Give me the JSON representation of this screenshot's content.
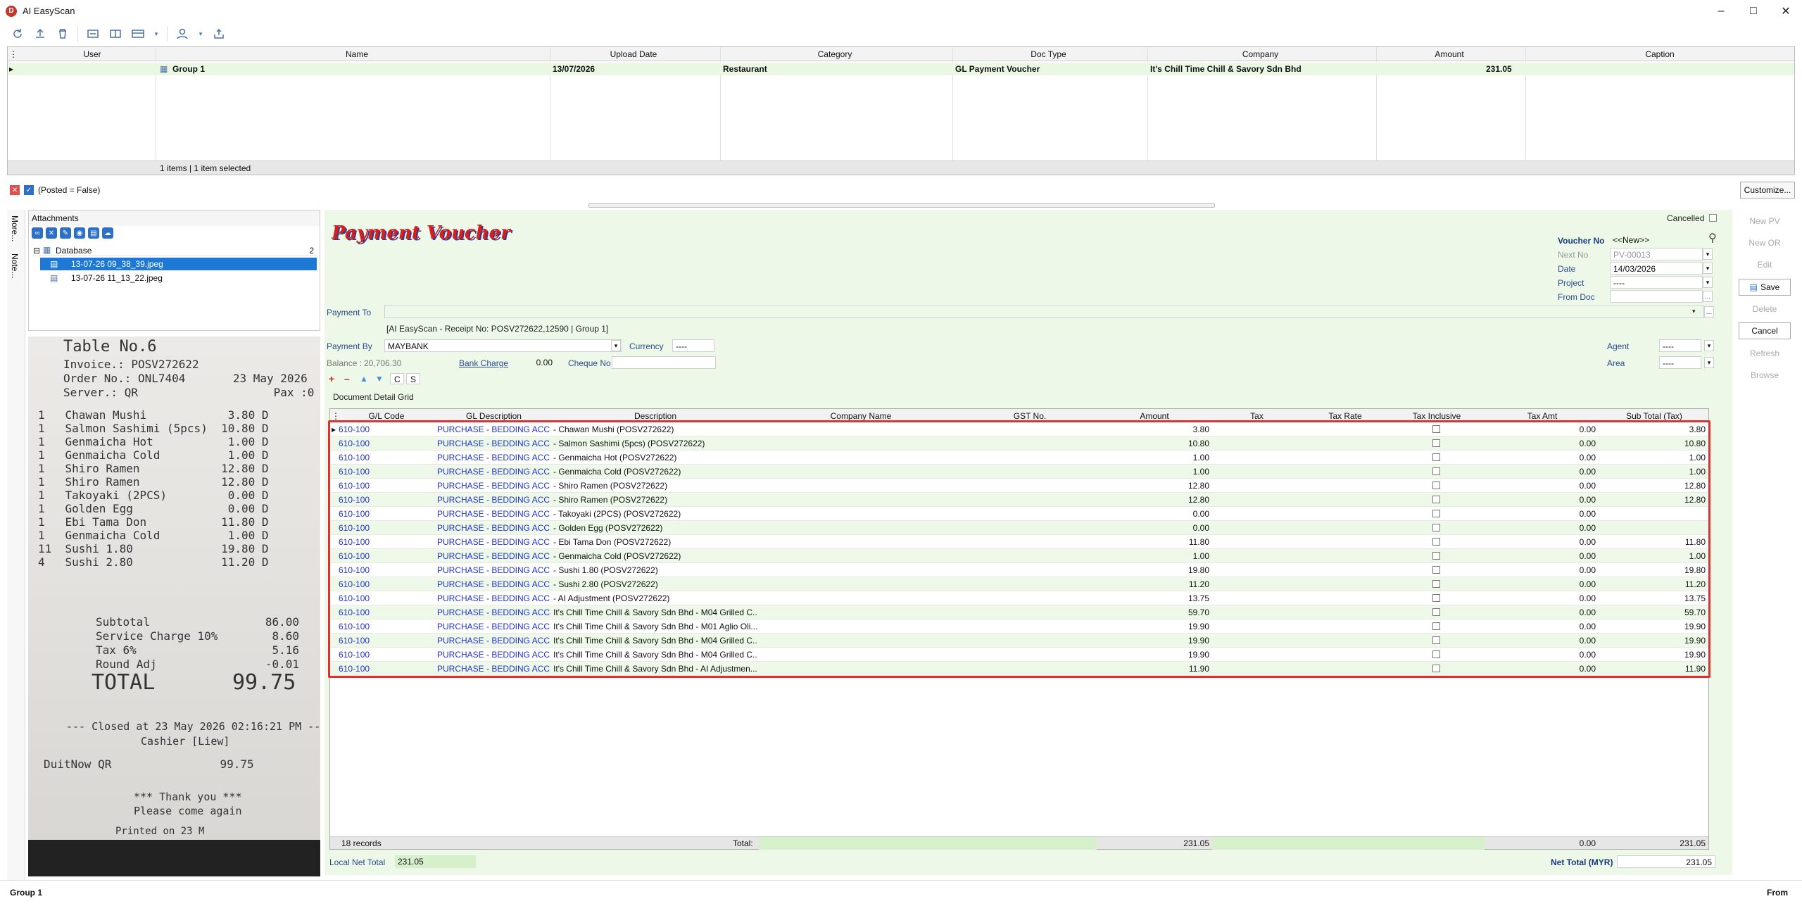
{
  "app": {
    "title": "AI EasyScan",
    "logo": "D"
  },
  "top_grid": {
    "columns": [
      "User",
      "Name",
      "Upload Date",
      "Category",
      "Doc Type",
      "Company",
      "Amount",
      "Caption"
    ],
    "row": {
      "name": "Group 1",
      "upload_date": "13/07/2026",
      "category": "Restaurant",
      "doc_type": "GL Payment Voucher",
      "company": "It's Chill Time Chill & Savory Sdn Bhd",
      "amount": "231.05"
    },
    "footer": "1 items | 1 item selected"
  },
  "filter": {
    "text": "(Posted = False)",
    "customize_label": "Customize..."
  },
  "side_tabs": {
    "more": "More...",
    "note": "Note..."
  },
  "attachments": {
    "title": "Attachments",
    "root_label": "Database",
    "root_count": "2",
    "files": [
      "13-07-26 09_38_39.jpeg",
      "13-07-26 11_13_22.jpeg"
    ]
  },
  "receipt": {
    "lines": [
      "Table No.6",
      "Invoice.: POSV272622",
      "Order No.: ONL7404       23 May 2026",
      "Server.: QR                    Pax :0",
      "1   Chawan Mushi            3.80 D",
      "1   Salmon Sashimi (5pcs)  10.80 D",
      "1   Genmaicha Hot           1.00 D",
      "1   Genmaicha Cold          1.00 D",
      "1   Shiro Ramen            12.80 D",
      "1   Shiro Ramen            12.80 D",
      "1   Takoyaki (2PCS)         0.00 D",
      "1   Golden Egg              0.00 D",
      "1   Ebi Tama Don           11.80 D",
      "1   Genmaicha Cold          1.00 D",
      "11  Sushi 1.80             19.80 D",
      "4   Sushi 2.80             11.20 D",
      "Subtotal                 86.00",
      "Service Charge 10%        8.60",
      "Tax 6%                    5.16",
      "Round Adj                -0.01",
      "TOTAL",
      "99.75",
      "--- Closed at 23 May 2026 02:16:21 PM ---",
      "Cashier [Liew]",
      "DuitNow QR                99.75",
      "*** Thank you ***",
      "Please come again",
      "Printed on 23 M"
    ]
  },
  "voucher": {
    "title": "Payment Voucher",
    "cancelled_label": "Cancelled",
    "voucher_no_label": "Voucher No",
    "voucher_no": "<<New>>",
    "next_no_label": "Next No",
    "next_no": "PV-00013",
    "date_label": "Date",
    "date": "14/03/2026",
    "project_label": "Project",
    "project": "----",
    "from_doc_label": "From Doc",
    "payment_to_label": "Payment To",
    "payment_desc": "[AI EasyScan - Receipt No: POSV272622,12590 | Group 1]",
    "payment_by_label": "Payment By",
    "payment_by": "MAYBANK",
    "currency_label": "Currency",
    "currency": "----",
    "balance_label": "Balance :",
    "balance": "20,706.30",
    "bank_charge_label": "Bank Charge",
    "bank_charge": "0.00",
    "cheque_no_label": "Cheque No",
    "agent_label": "Agent",
    "agent": "----",
    "area_label": "Area",
    "area": "----",
    "grid_caption": "Document Detail Grid",
    "btn_c": "C",
    "btn_s": "S",
    "local_net_total_label": "Local Net Total",
    "local_net_total": "231.05",
    "net_total_label": "Net Total (MYR)",
    "net_total": "231.05"
  },
  "side_buttons": {
    "new_pv": "New PV",
    "new_or": "New OR",
    "edit": "Edit",
    "save": "Save",
    "delete": "Delete",
    "cancel": "Cancel",
    "refresh": "Refresh",
    "browse": "Browse"
  },
  "detail_grid": {
    "columns": [
      "G/L Code",
      "GL Description",
      "Description",
      "Company Name",
      "GST No.",
      "Amount",
      "Tax",
      "Tax Rate",
      "Tax Inclusive",
      "Tax Amt",
      "Sub Total (Tax)"
    ],
    "rows": [
      {
        "gl": "610-100",
        "gld": "PURCHASE - BEDDING ACC...",
        "desc": " - Chawan Mushi (POSV272622)",
        "amount": "3.80",
        "tax_amt": "0.00",
        "sub": "3.80"
      },
      {
        "gl": "610-100",
        "gld": "PURCHASE - BEDDING ACC...",
        "desc": " - Salmon Sashimi (5pcs) (POSV272622)",
        "amount": "10.80",
        "tax_amt": "0.00",
        "sub": "10.80"
      },
      {
        "gl": "610-100",
        "gld": "PURCHASE - BEDDING ACC...",
        "desc": " - Genmaicha Hot (POSV272622)",
        "amount": "1.00",
        "tax_amt": "0.00",
        "sub": "1.00"
      },
      {
        "gl": "610-100",
        "gld": "PURCHASE - BEDDING ACC...",
        "desc": " - Genmaicha Cold (POSV272622)",
        "amount": "1.00",
        "tax_amt": "0.00",
        "sub": "1.00"
      },
      {
        "gl": "610-100",
        "gld": "PURCHASE - BEDDING ACC...",
        "desc": " - Shiro Ramen (POSV272622)",
        "amount": "12.80",
        "tax_amt": "0.00",
        "sub": "12.80"
      },
      {
        "gl": "610-100",
        "gld": "PURCHASE - BEDDING ACC...",
        "desc": " - Shiro Ramen (POSV272622)",
        "amount": "12.80",
        "tax_amt": "0.00",
        "sub": "12.80"
      },
      {
        "gl": "610-100",
        "gld": "PURCHASE - BEDDING ACC...",
        "desc": " - Takoyaki (2PCS) (POSV272622)",
        "amount": "0.00",
        "tax_amt": "0.00",
        "sub": ""
      },
      {
        "gl": "610-100",
        "gld": "PURCHASE - BEDDING ACC...",
        "desc": " - Golden Egg (POSV272622)",
        "amount": "0.00",
        "tax_amt": "0.00",
        "sub": ""
      },
      {
        "gl": "610-100",
        "gld": "PURCHASE - BEDDING ACC...",
        "desc": " - Ebi Tama Don (POSV272622)",
        "amount": "11.80",
        "tax_amt": "0.00",
        "sub": "11.80"
      },
      {
        "gl": "610-100",
        "gld": "PURCHASE - BEDDING ACC...",
        "desc": " - Genmaicha Cold (POSV272622)",
        "amount": "1.00",
        "tax_amt": "0.00",
        "sub": "1.00"
      },
      {
        "gl": "610-100",
        "gld": "PURCHASE - BEDDING ACC...",
        "desc": " - Sushi 1.80 (POSV272622)",
        "amount": "19.80",
        "tax_amt": "0.00",
        "sub": "19.80"
      },
      {
        "gl": "610-100",
        "gld": "PURCHASE - BEDDING ACC...",
        "desc": " - Sushi 2.80 (POSV272622)",
        "amount": "11.20",
        "tax_amt": "0.00",
        "sub": "11.20"
      },
      {
        "gl": "610-100",
        "gld": "PURCHASE - BEDDING ACC...",
        "desc": " - AI Adjustment (POSV272622)",
        "amount": "13.75",
        "tax_amt": "0.00",
        "sub": "13.75"
      },
      {
        "gl": "610-100",
        "gld": "PURCHASE - BEDDING ACC...",
        "desc": "It's Chill Time Chill & Savory Sdn Bhd - M04 Grilled C...",
        "amount": "59.70",
        "tax_amt": "0.00",
        "sub": "59.70"
      },
      {
        "gl": "610-100",
        "gld": "PURCHASE - BEDDING ACC...",
        "desc": "It's Chill Time Chill & Savory Sdn Bhd - M01 Aglio Oli...",
        "amount": "19.90",
        "tax_amt": "0.00",
        "sub": "19.90"
      },
      {
        "gl": "610-100",
        "gld": "PURCHASE - BEDDING ACC...",
        "desc": "It's Chill Time Chill & Savory Sdn Bhd - M04 Grilled C...",
        "amount": "19.90",
        "tax_amt": "0.00",
        "sub": "19.90"
      },
      {
        "gl": "610-100",
        "gld": "PURCHASE - BEDDING ACC...",
        "desc": "It's Chill Time Chill & Savory Sdn Bhd - M04 Grilled C...",
        "amount": "19.90",
        "tax_amt": "0.00",
        "sub": "19.90"
      },
      {
        "gl": "610-100",
        "gld": "PURCHASE - BEDDING ACC...",
        "desc": "It's Chill Time Chill & Savory Sdn Bhd - AI Adjustmen...",
        "amount": "11.90",
        "tax_amt": "0.00",
        "sub": "11.90"
      }
    ],
    "footer": {
      "records": "18 records",
      "total_label": "Total:",
      "amount": "231.05",
      "tax_amt": "0.00",
      "sub": "231.05"
    }
  },
  "status": {
    "left": "Group 1",
    "right": "From"
  }
}
